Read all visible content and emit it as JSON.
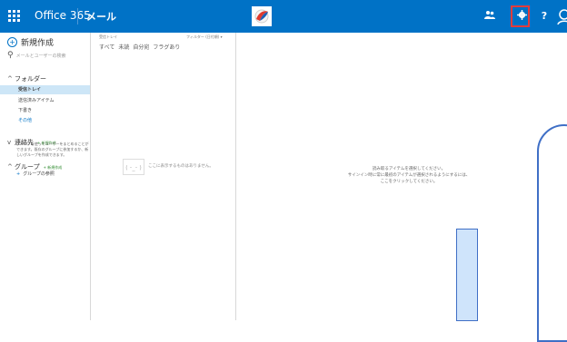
{
  "topbar": {
    "product": "Office 365",
    "app": "メール",
    "accent": "#0072c6",
    "highlight_color": "#e33c3c",
    "icons": [
      "waffle-icon",
      "office-logo-icon",
      "people-icon",
      "gear-icon",
      "help-icon",
      "avatar-icon"
    ],
    "help_label": "?"
  },
  "leftnav": {
    "new_label": "新規作成",
    "search_placeholder": "メールとユーザーの検索",
    "folders_header": "フォルダー",
    "folders": [
      {
        "label": "受信トレイ",
        "active": true
      },
      {
        "label": "送信済みアイテム"
      },
      {
        "label": "下書き"
      },
      {
        "label": "その他"
      }
    ],
    "contacts_header": "連絡先",
    "contacts_link": "+ 新規作成",
    "groups_header": "グループ",
    "groups_link": "+ 新規作成",
    "groups_desc": "グループを使ってユーザーをまとめることができます。既存のグループに参加するか、新しいグループを作成できます。",
    "groups_join": "グループの参照"
  },
  "listpane": {
    "inbox_label": "受信トレイ",
    "filter_label": "フィルター (日付順) ▾",
    "tabs": [
      "すべて",
      "未読",
      "自分宛",
      "フラグあり"
    ],
    "empty_face": "( ･_･ )",
    "empty_text": "ここに表示するものはありません。"
  },
  "readingpane": {
    "line1": "読み取るアイテムを選択してください。",
    "line2": "サインイン時に常に最初のアイテムが選択されるようにするには、",
    "line3": "ここをクリックしてください。"
  }
}
